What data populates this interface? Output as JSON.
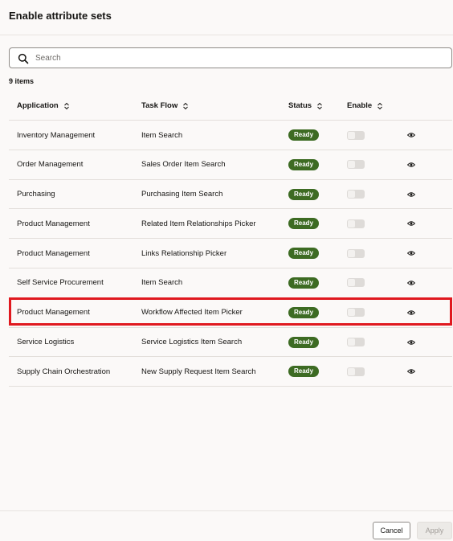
{
  "dialog": {
    "title": "Enable attribute sets"
  },
  "search": {
    "placeholder": "Search",
    "value": ""
  },
  "table": {
    "count_label": "9 items",
    "columns": [
      "Application",
      "Task Flow",
      "Status",
      "Enable"
    ],
    "rows": [
      {
        "application": "Inventory Management",
        "task_flow": "Item Search",
        "status": "Ready",
        "enabled": false
      },
      {
        "application": "Order Management",
        "task_flow": "Sales Order Item Search",
        "status": "Ready",
        "enabled": false
      },
      {
        "application": "Purchasing",
        "task_flow": "Purchasing Item Search",
        "status": "Ready",
        "enabled": false
      },
      {
        "application": "Product Management",
        "task_flow": "Related Item Relationships Picker",
        "status": "Ready",
        "enabled": false
      },
      {
        "application": "Product Management",
        "task_flow": "Links Relationship Picker",
        "status": "Ready",
        "enabled": false
      },
      {
        "application": "Self Service Procurement",
        "task_flow": "Item Search",
        "status": "Ready",
        "enabled": false
      },
      {
        "application": "Product Management",
        "task_flow": "Workflow Affected Item Picker",
        "status": "Ready",
        "enabled": false
      },
      {
        "application": "Service Logistics",
        "task_flow": "Service Logistics Item Search",
        "status": "Ready",
        "enabled": false
      },
      {
        "application": "Supply Chain Orchestration",
        "task_flow": "New Supply Request Item Search",
        "status": "Ready",
        "enabled": false
      }
    ]
  },
  "icons": {
    "search": "search-icon",
    "sort": "sort-icon",
    "view": "eye-icon"
  },
  "colors": {
    "status_badge": "#3d6b23",
    "highlight": "#e0191f"
  },
  "footer": {
    "cancel_label": "Cancel",
    "apply_label": "Apply"
  }
}
